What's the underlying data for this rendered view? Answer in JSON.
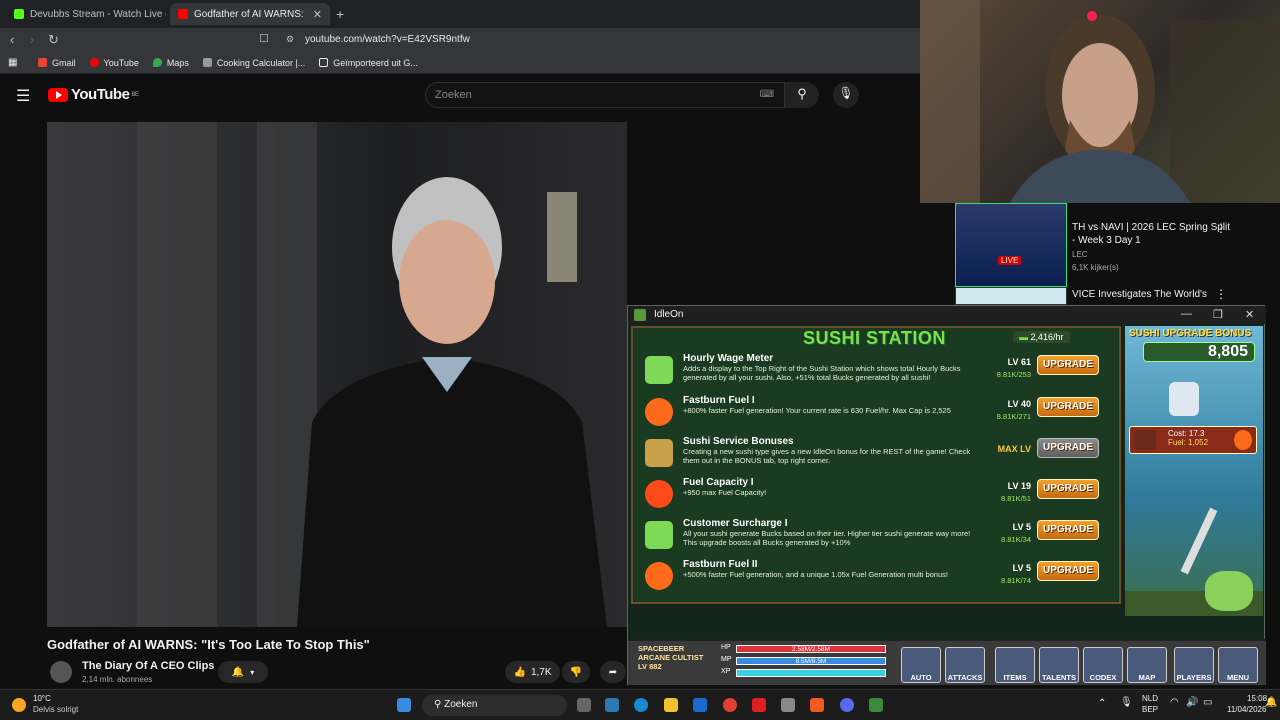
{
  "browser": {
    "tabs": [
      {
        "title": "Devubbs Stream - Watch Live on",
        "color": "#53fc18"
      },
      {
        "title": "Godfather of AI WARNS: \"It's",
        "color": "#ff0000"
      }
    ],
    "url": "youtube.com/watch?v=E42VSR9ntfw",
    "bookmarks": [
      "Gmail",
      "YouTube",
      "Maps",
      "Cooking Calculator |...",
      "Geïmporteerd uit G..."
    ]
  },
  "youtube": {
    "logo": "YouTube",
    "region": "BE",
    "search_placeholder": "Zoeken",
    "video_title": "Godfather of AI WARNS: \"It's Too Late To Stop This\"",
    "channel": "The Diary Of A CEO Clips",
    "subscribers": "2,14 mln. abonnees",
    "likes": "1,7K",
    "sidebar": [
      {
        "title": "TH vs NAVI | 2026 LEC Spring Split - Week 3 Day 1",
        "channel": "LEC",
        "meta": "6,1K kijker(s)",
        "badge": "LIVE"
      },
      {
        "title": "VICE Investigates The World's",
        "channel": "",
        "meta": "",
        "badge": ""
      }
    ]
  },
  "idleon": {
    "window_title": "IdleOn",
    "station_title": "SUSHI STATION",
    "rate": "2,416/hr",
    "upgrades": [
      {
        "name": "Hourly Wage Meter",
        "desc": "Adds a display to the Top Right of the Sushi Station which shows total Hourly Bucks generated by all your sushi. Also, +51% total Bucks generated by all sushi!",
        "level": "LV 61",
        "cost": "8.81K/253",
        "button": "UPGRADE",
        "color": "#7ed957"
      },
      {
        "name": "Fastburn Fuel I",
        "desc": "+800% faster Fuel generation! Your current rate is 630 Fuel/hr. Max Cap is 2,525",
        "level": "LV 40",
        "cost": "8.81K/271",
        "button": "UPGRADE",
        "color": "#ff6a1a"
      },
      {
        "name": "Sushi Service Bonuses",
        "desc": "Creating a new sushi type gives a new IdleOn bonus for the REST of the game! Check them out in the BONUS tab, top right corner.",
        "level": "MAX LV",
        "cost": "",
        "button": "UPGRADE",
        "color": "#c8a04a"
      },
      {
        "name": "Fuel Capacity I",
        "desc": "+950 max Fuel Capacity!",
        "level": "LV 19",
        "cost": "8.81K/51",
        "button": "UPGRADE",
        "color": "#ff4a1a"
      },
      {
        "name": "Customer Surcharge I",
        "desc": "All your sushi generate Bucks based on their tier. Higher tier sushi generate way more! This upgrade boosts all Bucks generated by +10%",
        "level": "LV 5",
        "cost": "8.81K/34",
        "button": "UPGRADE",
        "color": "#7ed957"
      },
      {
        "name": "Fastburn Fuel II",
        "desc": "+500% faster Fuel generation, and a unique 1.05x Fuel Generation multi bonus!",
        "level": "LV 5",
        "cost": "8.81K/74",
        "button": "UPGRADE",
        "color": "#ff6a1a"
      }
    ],
    "bonus_title": "SUSHI UPGRADE BONUS",
    "bonus_value": "8,805",
    "cost_line": "Cost: 17.3",
    "fuel_line": "Fuel: 1,052",
    "player": {
      "name": "SPACEBEER",
      "class": "ARCANE CULTIST",
      "level": "LV 882"
    },
    "bars": [
      {
        "label": "HP",
        "value": "2.58M/2.58M",
        "color": "#e0303a"
      },
      {
        "label": "MP",
        "value": "8.5M/8.5M",
        "color": "#3a8ae0"
      },
      {
        "label": "XP",
        "value": "",
        "color": "#3ad0e0"
      }
    ],
    "hud_buttons": [
      "AUTO",
      "ATTACKS",
      "ITEMS",
      "TALENTS",
      "CODEX",
      "MAP",
      "PLAYERS",
      "MENU"
    ]
  },
  "taskbar": {
    "temp": "10°C",
    "weather": "Delvis solrigt",
    "search": "Zoeken",
    "lang1": "NLD",
    "lang2": "BEP",
    "time": "15:08",
    "date": "11/04/2026"
  }
}
